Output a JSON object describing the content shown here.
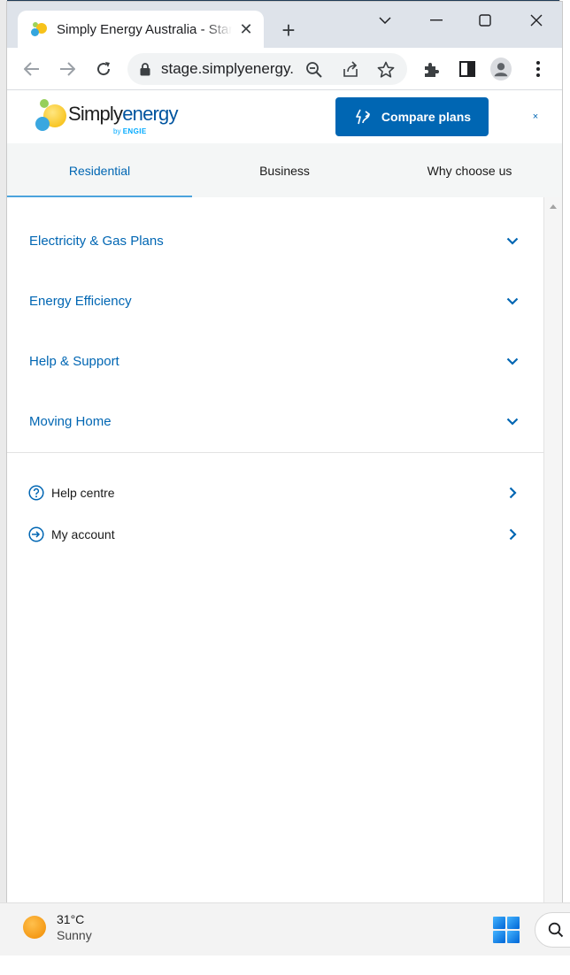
{
  "browser": {
    "tab_title": "Simply Energy Australia - Start",
    "tab_close_label": "✕",
    "new_tab_label": "+",
    "url": "stage.simplyenergy.com.au"
  },
  "site": {
    "logo_word_main": "Simply",
    "logo_word_accent": "energy",
    "logo_by": "by",
    "logo_brand": "ENGIE",
    "compare_label": "Compare plans",
    "close_label": "×"
  },
  "nav": {
    "tabs": [
      {
        "label": "Residential",
        "active": true
      },
      {
        "label": "Business",
        "active": false
      },
      {
        "label": "Why choose us",
        "active": false
      }
    ]
  },
  "menu": {
    "sections": [
      {
        "label": "Electricity & Gas Plans"
      },
      {
        "label": "Energy Efficiency"
      },
      {
        "label": "Help & Support"
      },
      {
        "label": "Moving Home"
      }
    ],
    "utility_links": [
      {
        "label": "Help centre",
        "icon": "question-circle-icon"
      },
      {
        "label": "My account",
        "icon": "sign-in-icon"
      }
    ]
  },
  "taskbar": {
    "temperature": "31°C",
    "condition": "Sunny"
  },
  "colors": {
    "brand_blue": "#0066b3",
    "accent_underline": "#4ca3dd",
    "nav_bg": "#f4f6f6"
  }
}
